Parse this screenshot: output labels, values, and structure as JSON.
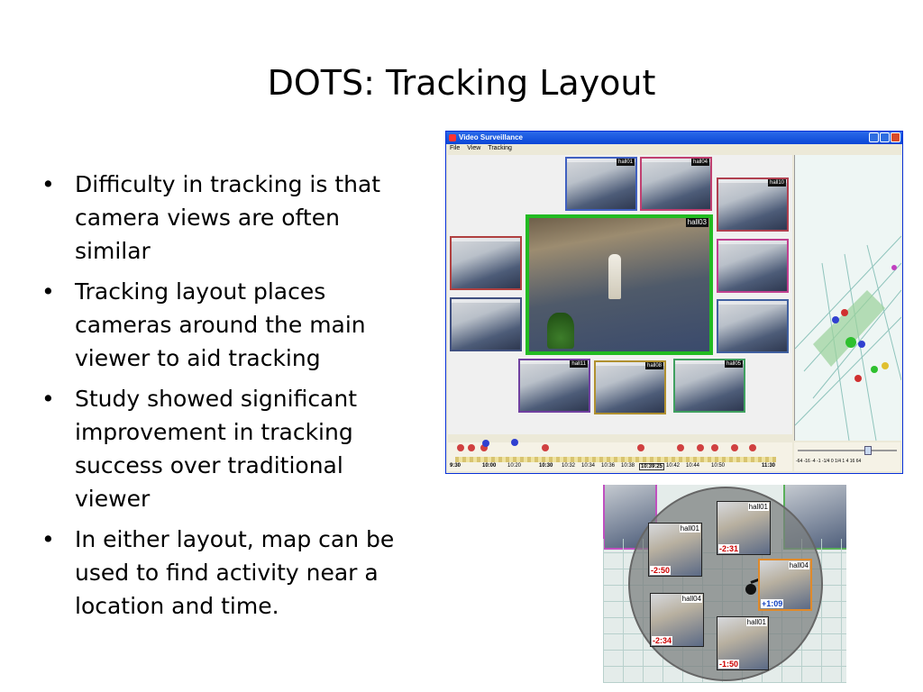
{
  "slide": {
    "title": "DOTS: Tracking Layout",
    "bullets": [
      "Difficulty in tracking is that camera views are often similar",
      "Tracking layout places cameras around the main viewer to aid tracking",
      "Study showed significant improvement in tracking success over traditional viewer",
      "In either layout, map can be used to find activity near a location and time."
    ],
    "bullet_glyph": "•"
  },
  "screenshot_window": {
    "title": "Video Surveillance",
    "menu": [
      "File",
      "View",
      "Tracking"
    ],
    "main_camera_label": "hall03",
    "camera_labels": [
      "hall01",
      "hall04",
      "hall10",
      "hall11",
      "hall08",
      "hall05"
    ],
    "timeline_labels": [
      "9:30",
      "10:00",
      "10:20",
      "10:30",
      "10:32",
      "10:34",
      "10:36",
      "10:38",
      "10:39:25",
      "10:42",
      "10:44",
      "10:50",
      "11:30"
    ],
    "zoom_labels": "-64 -16 -4 -1 -1/4 0 1/4 1 4 16 64",
    "colors": {
      "main_frame": "#22bb22",
      "title_bar": "#0a46d6",
      "timeline_marker_red": "#d04040",
      "timeline_marker_blue": "#3040d0"
    }
  },
  "map_overlay": {
    "thumbnails": [
      {
        "label": "hall01",
        "time": "-2:50",
        "color": "red"
      },
      {
        "label": "hall01",
        "time": "-2:31",
        "color": "red"
      },
      {
        "label": "hall04",
        "time": "+1:09",
        "color": "blue"
      },
      {
        "label": "hall04",
        "time": "-2:34",
        "color": "red"
      },
      {
        "label": "hall01",
        "time": "-1:50",
        "color": "red"
      }
    ],
    "highlight_color": "#e08a2a"
  }
}
